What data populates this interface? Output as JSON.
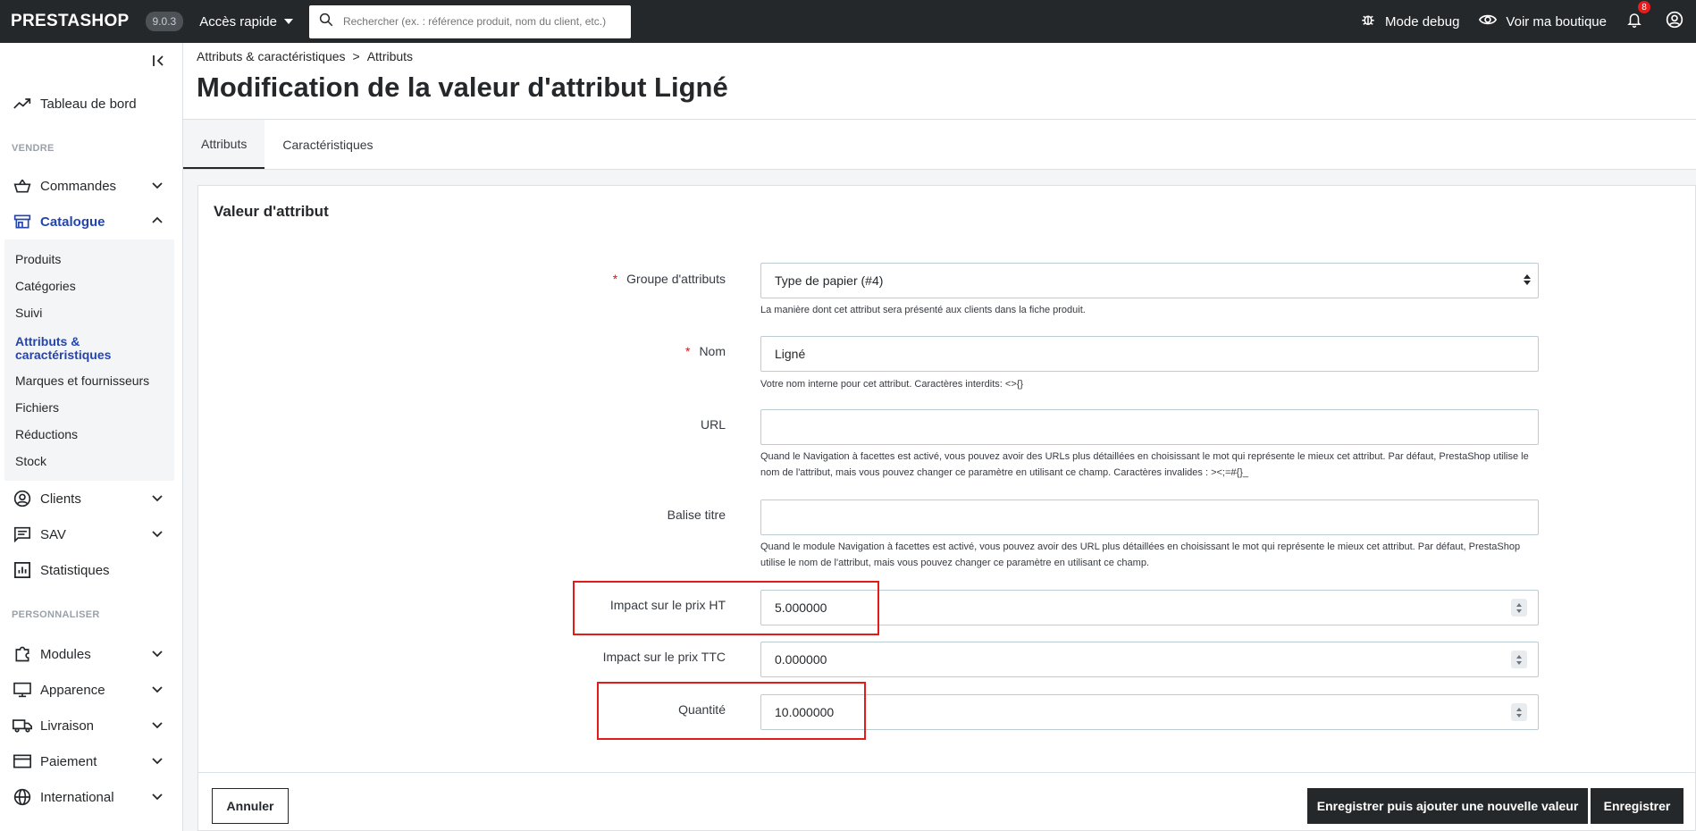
{
  "header": {
    "logo": "PRESTASHOP",
    "version": "9.0.3",
    "quick_access": "Accès rapide",
    "search_placeholder": "Rechercher (ex. : référence produit, nom du client, etc.)",
    "debug_mode": "Mode debug",
    "view_shop": "Voir ma boutique",
    "notifications_count": "8"
  },
  "sidebar": {
    "dashboard": "Tableau de bord",
    "section_sell": "VENDRE",
    "orders": "Commandes",
    "catalog": "Catalogue",
    "catalog_items": [
      "Produits",
      "Catégories",
      "Suivi",
      "Attributs & caractéristiques",
      "Marques et fournisseurs",
      "Fichiers",
      "Réductions",
      "Stock"
    ],
    "clients": "Clients",
    "sav": "SAV",
    "stats": "Statistiques",
    "section_customize": "PERSONNALISER",
    "modules": "Modules",
    "appearance": "Apparence",
    "shipping": "Livraison",
    "payment": "Paiement",
    "international": "International"
  },
  "breadcrumb": {
    "parent": "Attributs & caractéristiques",
    "separator": ">",
    "current": "Attributs"
  },
  "page": {
    "title": "Modification de la valeur d'attribut Ligné"
  },
  "tabs": {
    "attributes": "Attributs",
    "features": "Caractéristiques"
  },
  "form": {
    "card_title": "Valeur d'attribut",
    "required_mark": "*",
    "group_label": "Groupe d'attributs",
    "group_value": "Type de papier (#4)",
    "group_help": "La manière dont cet attribut sera présenté aux clients dans la fiche produit.",
    "name_label": "Nom",
    "name_value": "Ligné",
    "name_help": "Votre nom interne pour cet attribut. Caractères interdits: <>{}",
    "url_label": "URL",
    "url_value": "",
    "url_help": "Quand le Navigation à facettes est activé, vous pouvez avoir des URLs plus détaillées en choisissant le mot qui représente le mieux cet attribut. Par défaut, PrestaShop utilise le nom de l'attribut, mais vous pouvez changer ce paramètre en utilisant ce champ. Caractères invalides : ><;=#{}_",
    "meta_title_label": "Balise titre",
    "meta_title_value": "",
    "meta_title_help": "Quand le module Navigation à facettes est activé, vous pouvez avoir des URL plus détaillées en choisissant le mot qui représente le mieux cet attribut. Par défaut, PrestaShop utilise le nom de l'attribut, mais vous pouvez changer ce paramètre en utilisant ce champ.",
    "price_ht_label": "Impact sur le prix HT",
    "price_ht_value": "5.000000",
    "price_ttc_label": "Impact sur le prix TTC",
    "price_ttc_value": "0.000000",
    "quantity_label": "Quantité",
    "quantity_value": "10.000000"
  },
  "actions": {
    "cancel": "Annuler",
    "save_and_new": "Enregistrer puis ajouter une nouvelle valeur",
    "save": "Enregistrer"
  },
  "colors": {
    "header_bg": "#25282b",
    "accent_active": "#2545ad",
    "highlight_box": "#e21b1b",
    "badge": "#e71c1c"
  }
}
